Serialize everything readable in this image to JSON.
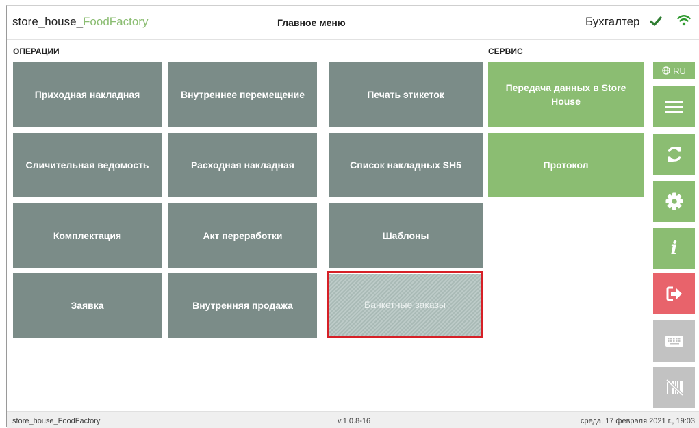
{
  "header": {
    "app_name_prefix": "store_house_",
    "app_name_suffix": "FoodFactory",
    "menu_title": "Главное меню",
    "user": "Бухгалтер"
  },
  "sections": {
    "operations": "ОПЕРАЦИИ",
    "service": "СЕРВИС"
  },
  "tiles": [
    "Приходная накладная",
    "Внутреннее перемещение",
    "Печать этикеток",
    "Сличительная ведомость",
    "Расходная накладная",
    "Список накладных SH5",
    "Комплектация",
    "Акт переработки",
    "Шаблоны",
    "Заявка",
    "Внутренняя продажа",
    "Банкетные заказы"
  ],
  "service_tiles": [
    "Передача данных в Store House",
    "Протокол"
  ],
  "sidebar": {
    "language": "RU"
  },
  "footer": {
    "app_name": "store_house_FoodFactory",
    "version": "v.1.0.8-16",
    "datetime": "среда, 17 февраля 2021 г., 19:03"
  },
  "colors": {
    "tile": "#7b8c88",
    "green": "#8bbd72",
    "red": "#e8636b",
    "disabled": "#c2c2c2",
    "highlight": "#d62027"
  }
}
